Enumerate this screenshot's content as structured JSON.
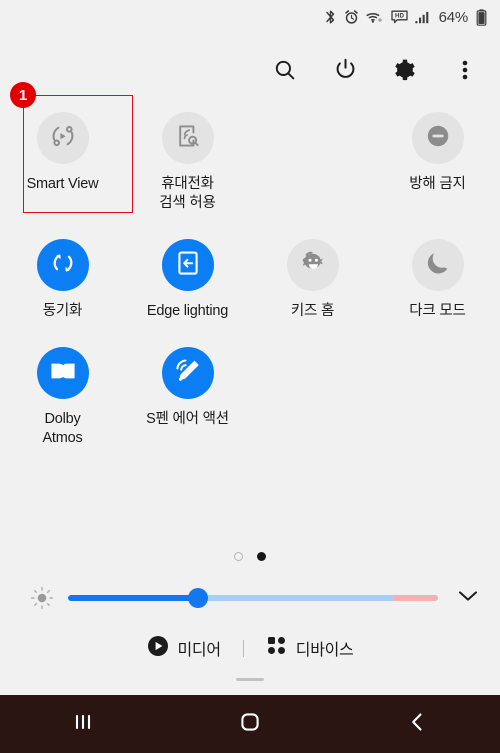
{
  "statusbar": {
    "icons": [
      "bluetooth-icon",
      "alarm-icon",
      "wifi-icon",
      "hd-icon",
      "signal-icon"
    ],
    "battery_percent": "64%",
    "battery_icon": "battery-icon"
  },
  "toolbar": {
    "search_label": "search-icon",
    "power_label": "power-icon",
    "settings_label": "gear-icon",
    "more_label": "more-vertical-icon"
  },
  "tiles": [
    {
      "label": "Smart View",
      "state": "off",
      "icon": "smart-view-icon"
    },
    {
      "label": "휴대전화\n검색 허용",
      "state": "off",
      "icon": "phone-scan-icon"
    },
    {
      "label": "",
      "state": "empty",
      "icon": ""
    },
    {
      "label": "방해 금지",
      "state": "off",
      "icon": "do-not-disturb-icon"
    },
    {
      "label": "동기화",
      "state": "on",
      "icon": "sync-icon"
    },
    {
      "label": "Edge lighting",
      "state": "on",
      "icon": "edge-lighting-icon"
    },
    {
      "label": "키즈 홈",
      "state": "off",
      "icon": "kids-home-icon"
    },
    {
      "label": "다크 모드",
      "state": "off",
      "icon": "dark-mode-icon"
    },
    {
      "label": "Dolby\nAtmos",
      "state": "on",
      "icon": "dolby-atmos-icon"
    },
    {
      "label": "S펜 에어 액션",
      "state": "on",
      "icon": "s-pen-air-action-icon"
    },
    {
      "label": "",
      "state": "empty",
      "icon": ""
    },
    {
      "label": "",
      "state": "empty",
      "icon": ""
    }
  ],
  "pager": {
    "pages": 2,
    "current": 2
  },
  "brightness": {
    "sun_icon": "brightness-icon",
    "value_percent": 35,
    "warn_start_percent": 88,
    "expand_icon": "chevron-down-icon"
  },
  "footer": {
    "media_label": "미디어",
    "media_icon": "play-circle-icon",
    "devices_label": "디바이스",
    "devices_icon": "grid-dots-icon"
  },
  "navbar": {
    "recents_icon": "recents-icon",
    "home_icon": "home-icon",
    "back_icon": "back-icon"
  },
  "annotation": {
    "badge": "1",
    "target": "Smart View"
  },
  "colors": {
    "background": "#f1f1f1",
    "accent_blue": "#0b7ef4",
    "inactive_grey": "#e3e3e3",
    "annotation_red": "#e50914",
    "navbar": "#2a1512"
  }
}
